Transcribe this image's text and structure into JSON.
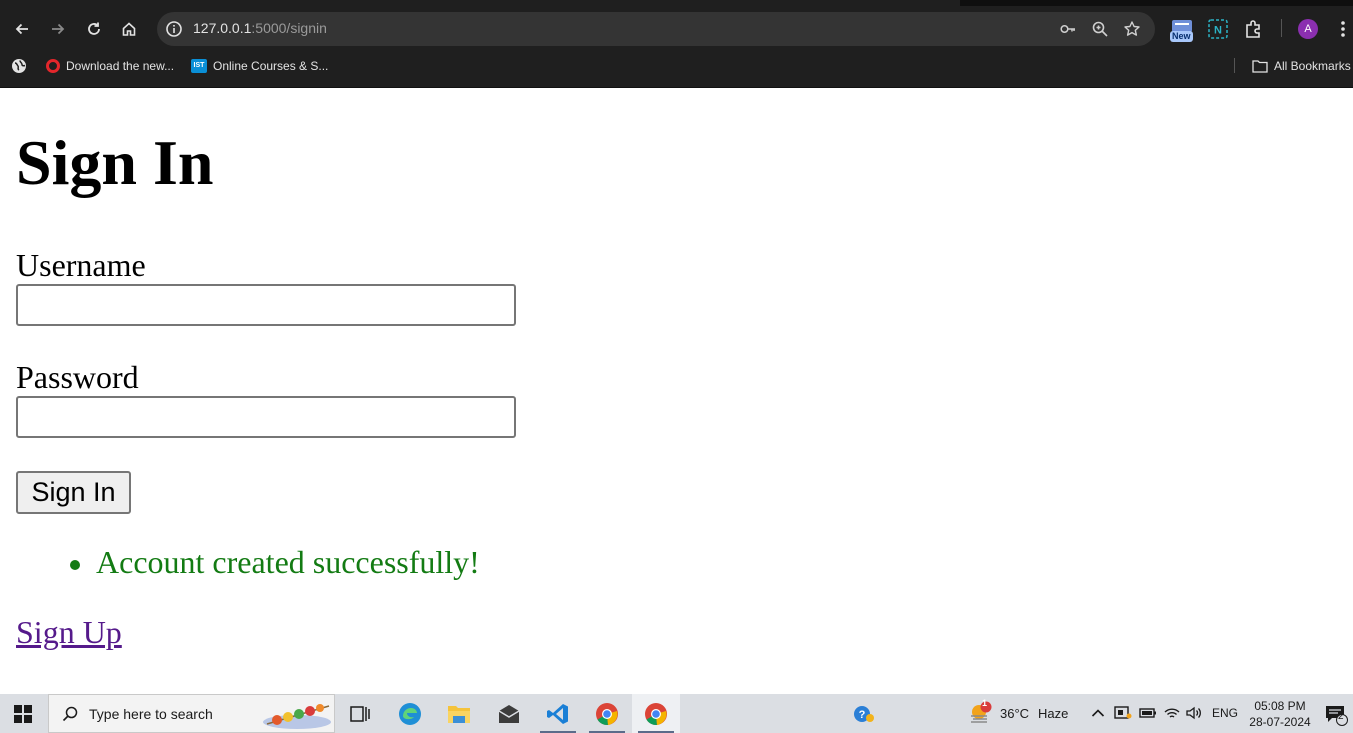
{
  "browser": {
    "url_host": "127.0.0.1",
    "url_rest": ":5000/signin",
    "new_badge": "New",
    "profile_initial": "A",
    "bookmarks": [
      {
        "label": "Download the new..."
      },
      {
        "label": "Online Courses & S..."
      }
    ],
    "all_bookmarks_label": "All Bookmarks",
    "ist_label": "IST"
  },
  "page": {
    "title": "Sign In",
    "username_label": "Username",
    "username_value": "",
    "password_label": "Password",
    "password_value": "",
    "submit_label": "Sign In",
    "messages": [
      "Account created successfully!"
    ],
    "signup_link": "Sign Up"
  },
  "taskbar": {
    "search_placeholder": "Type here to search",
    "weather_temp": "36°C",
    "weather_desc": "Haze",
    "weather_badge": "1",
    "language": "ENG",
    "time": "05:08 PM",
    "date": "28-07-2024",
    "notification_count": "2"
  },
  "colors": {
    "chrome_bg": "#1f1f1f",
    "omnibox_bg": "#343434",
    "flash_green": "#137b13",
    "link_visited": "#551a8b",
    "taskbar_bg": "#dbdee3"
  }
}
